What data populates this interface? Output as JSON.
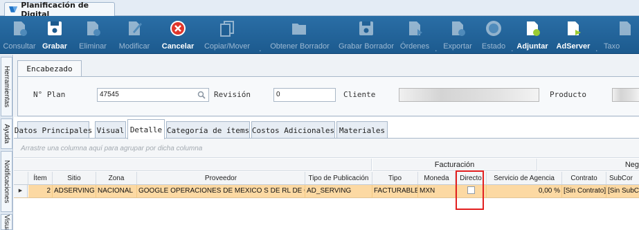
{
  "window": {
    "tab_title": "Planificación de Digital"
  },
  "ribbon": {
    "buttons": [
      {
        "label": "Consultar",
        "icon": "consult-icon",
        "enabled": false
      },
      {
        "label": "Grabar",
        "icon": "save-icon",
        "enabled": true
      },
      {
        "label": "Eliminar",
        "icon": "delete-icon",
        "enabled": false
      },
      {
        "label": "Modificar",
        "icon": "edit-icon",
        "enabled": false
      },
      {
        "label": "Cancelar",
        "icon": "cancel-icon",
        "enabled": true
      },
      {
        "label": "Copiar/Mover",
        "icon": "copy-icon",
        "enabled": false
      },
      {
        "label": "Obtener Borrador",
        "icon": "folder-open-icon",
        "enabled": false
      },
      {
        "label": "Grabar Borrador",
        "icon": "save-draft-icon",
        "enabled": false
      },
      {
        "label": "Órdenes",
        "icon": "orders-icon",
        "enabled": false
      },
      {
        "label": "Exportar",
        "icon": "export-icon",
        "enabled": false
      },
      {
        "label": "Estado",
        "icon": "status-icon",
        "enabled": false
      },
      {
        "label": "Adjuntar",
        "icon": "attach-icon",
        "enabled": true
      },
      {
        "label": "AdServer",
        "icon": "adserver-icon",
        "enabled": true
      },
      {
        "label": "Taxo",
        "icon": "taxonomy-icon",
        "enabled": false
      }
    ]
  },
  "side_tabs": [
    "Herramientas",
    "Ayuda",
    "Notificaciones",
    "Visual"
  ],
  "header": {
    "group_tab": "Encabezado",
    "plan_label": "N° Plan",
    "plan_value": "47545",
    "revision_label": "Revisión",
    "revision_value": "0",
    "cliente_label": "Cliente",
    "cliente_value": "",
    "producto_label": "Producto",
    "producto_value": ""
  },
  "detail_tabs": [
    "Datos Principales",
    "Visual",
    "Detalle",
    "Categoría de ítems",
    "Costos Adicionales",
    "Materiales"
  ],
  "active_detail_tab": "Detalle",
  "grid": {
    "group_hint": "Arrastre una columna aquí para agrupar por dicha columna",
    "bands": {
      "facturacion": "Facturación",
      "negocio": "Neg"
    },
    "columns": [
      "Ítem",
      "Sitio",
      "Zona",
      "Proveedor",
      "Tipo de Publicación",
      "Tipo",
      "Moneda",
      "Directo",
      "Servicio de Agencia",
      "Contrato",
      "SubCor"
    ],
    "rows": [
      {
        "item": "2",
        "sitio": "ADSERVING",
        "zona": "NACIONAL",
        "proveedor": "GOOGLE OPERACIONES DE MEXICO S DE RL DE CV",
        "tipo_publicacion": "AD_SERVING",
        "tipo": "FACTURABLE",
        "moneda": "MXN",
        "directo": false,
        "servicio_agencia": "0,00 %",
        "contrato": "[Sin Contrato]",
        "subcontrato": "[Sin SubC"
      }
    ]
  },
  "colors": {
    "ribbon": "#1c5a8e",
    "selected_row": "#fcd9a3",
    "highlight_box": "#e21f1f"
  }
}
